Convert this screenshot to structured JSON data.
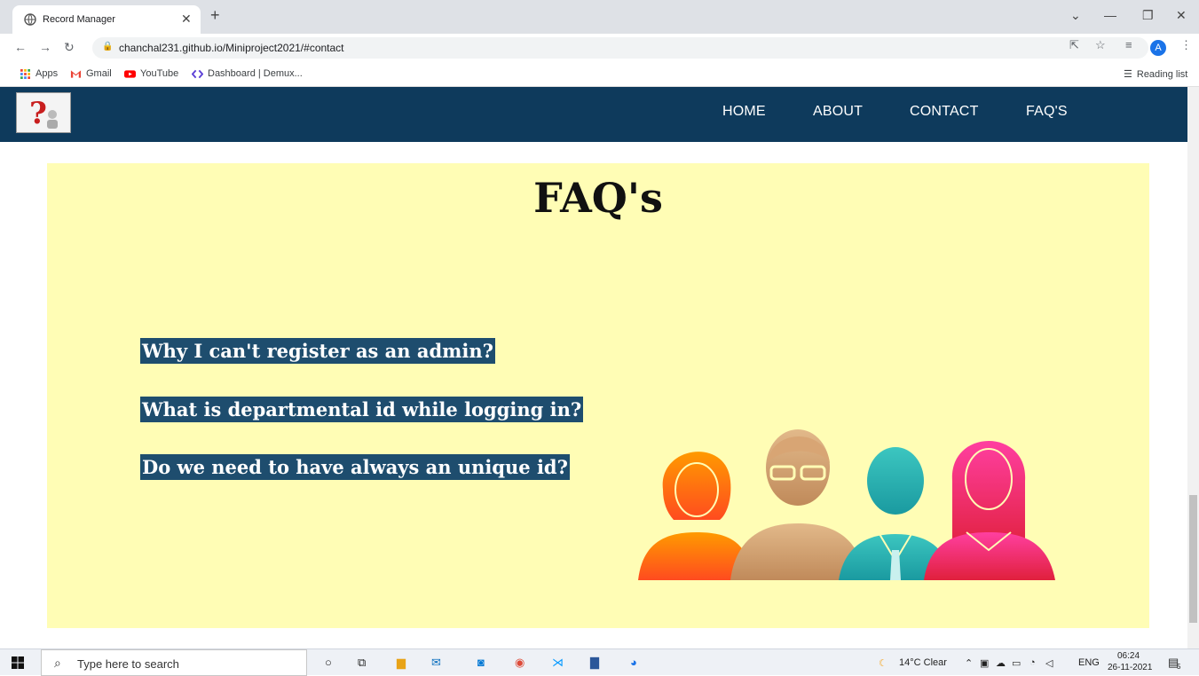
{
  "browser": {
    "tab_title": "Record Manager",
    "url": "chanchal231.github.io/Miniproject2021/#contact",
    "bookmarks": [
      "Apps",
      "Gmail",
      "YouTube",
      "Dashboard | Demux..."
    ],
    "reading_list": "Reading list",
    "profile_initial": "A"
  },
  "nav": {
    "links": [
      "HOME",
      "ABOUT",
      "CONTACT",
      "FAQ'S"
    ]
  },
  "faq": {
    "title": "FAQ's",
    "questions": [
      "Why I can't register as an admin?",
      "What is departmental id while logging in?",
      "Do we need to have always an unique id?"
    ]
  },
  "taskbar": {
    "search_placeholder": "Type here to search",
    "weather": "14°C  Clear",
    "lang": "ENG",
    "time": "06:24",
    "date": "26-11-2021",
    "notif_count": "5"
  },
  "colors": {
    "navbar": "#0e3a5c",
    "faq_bg": "#fffdb5",
    "question_bg": "#1e4d6e"
  }
}
